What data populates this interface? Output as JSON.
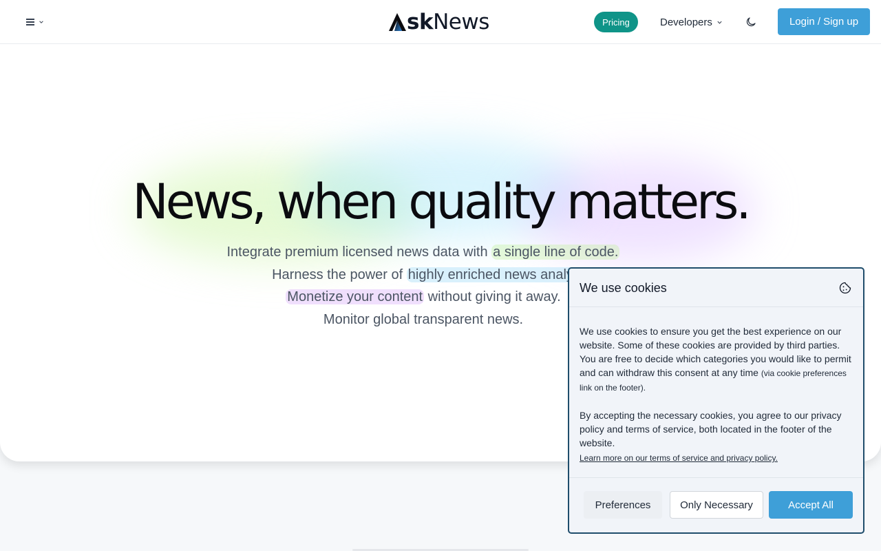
{
  "header": {
    "menu_icon": "hamburger-icon",
    "logo_a": "A",
    "logo_sk": "sk",
    "logo_news": "News",
    "pricing_label": "Pricing",
    "developers_label": "Developers",
    "theme_icon": "moon-icon",
    "login_label": "Login / Sign up"
  },
  "hero": {
    "headline": "News, when quality matters.",
    "lines": [
      {
        "pre": "Integrate premium licensed news data with ",
        "highlight": "a single line of code.",
        "post": ""
      },
      {
        "pre": "Harness the power of ",
        "highlight": "highly enriched news analy",
        "post": ""
      },
      {
        "pre": "",
        "highlight": "Monetize your content",
        "post": " without giving it away."
      },
      {
        "pre": "Monitor global transparent news.",
        "highlight": "",
        "post": ""
      }
    ]
  },
  "cookie_banner": {
    "title": "We use cookies",
    "icon": "cookie-icon",
    "para1": "We use cookies to ensure you get the best experience on our website. Some of these cookies are provided by third parties. You are free to decide which categories you would like to permit and can withdraw this consent at any time ",
    "para1_small": "(via cookie preferences link on the footer).",
    "para2": "By accepting the necessary cookies, you agree to our privacy policy and terms of service, both located in the footer of the website.",
    "learn_more": "Learn more on our terms of service and privacy policy.",
    "preferences_label": "Preferences",
    "only_necessary_label": "Only Necessary",
    "accept_all_label": "Accept All"
  },
  "colors": {
    "accent_blue": "#3e9fd8",
    "pricing_teal": "#0f9488",
    "cookie_border": "#1f4d6b"
  }
}
